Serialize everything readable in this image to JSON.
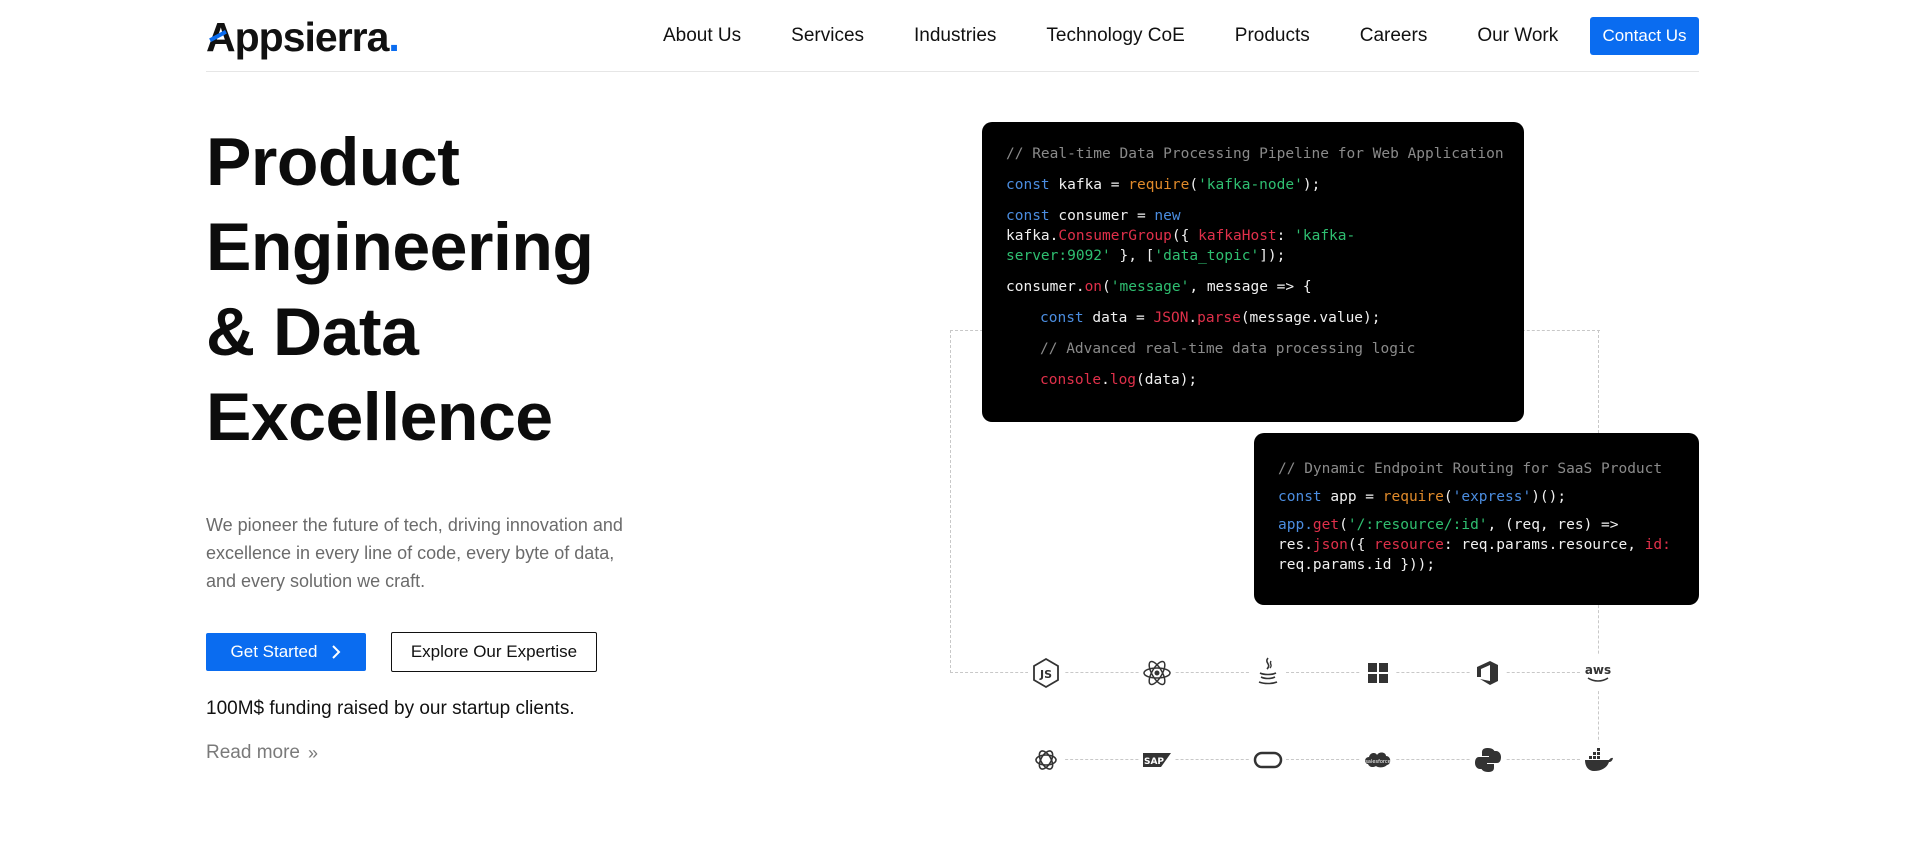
{
  "header": {
    "logo_text": "Appsierra",
    "logo_dot": ".",
    "nav": [
      "About Us",
      "Services",
      "Industries",
      "Technology CoE",
      "Products",
      "Careers",
      "Our Work"
    ],
    "contact_label": "Contact Us"
  },
  "hero": {
    "title_lines": [
      "Product",
      "Engineering",
      "& Data",
      "Excellence"
    ],
    "description": "We pioneer the future of tech, driving innovation and excellence in every line of code, every byte of data, and every solution we craft.",
    "primary_button": "Get Started",
    "secondary_button": "Explore Our Expertise",
    "funding_text": "100M$ funding raised by our startup clients.",
    "read_more": "Read more"
  },
  "code_card_1": {
    "comment": "// Real-time Data Processing Pipeline for Web Application",
    "l1_kw": "const",
    "l1_a": " kafka = ",
    "l1_fn": "require",
    "l1_b": "(",
    "l1_str": "'kafka-node'",
    "l1_c": ");",
    "l2_kw": "const",
    "l2_a": " consumer = ",
    "l2_kw2": "new",
    "l3_a": "kafka.",
    "l3_fn": "ConsumerGroup",
    "l3_b": "({ ",
    "l3_key": "kafkaHost",
    "l3_c": ": ",
    "l3_str": "'kafka-",
    "l4_str": "server:9092'",
    "l4_a": " }, [",
    "l4_str2": "'data_topic'",
    "l4_b": "]);",
    "l5_a": "consumer.",
    "l5_fn": "on",
    "l5_b": "(",
    "l5_str": "'message'",
    "l5_c": ", message => {",
    "l6_kw": "const",
    "l6_a": " data = ",
    "l6_fn": "JSON",
    "l6_b": ".",
    "l6_fn2": "parse",
    "l6_c": "(message.value);",
    "l7_cm": "// Advanced real-time data processing logic",
    "l8_fn": "console",
    "l8_a": ".",
    "l8_fn2": "log",
    "l8_b": "(data);"
  },
  "code_card_2": {
    "comment": "// Dynamic Endpoint Routing for SaaS Product",
    "l1_kw": "const",
    "l1_a": " app = ",
    "l1_fn": "require",
    "l1_b": "(",
    "l1_str": "'express'",
    "l1_c": ")();",
    "l2_kw": "app.",
    "l2_fn": "get",
    "l2_a": "(",
    "l2_str": "'/:resource/:id'",
    "l2_b": ", (req, res) =>",
    "l3_a": "res.",
    "l3_fn": "json",
    "l3_b": "({ ",
    "l3_key": "resource",
    "l3_c": ": req.params.resource, ",
    "l3_key2": "id:",
    "l4_a": "req.params.id }));"
  },
  "tech_icons": {
    "row1": [
      "nodejs-icon",
      "react-icon",
      "java-icon",
      "windows-icon",
      "azure-devops-icon",
      "aws-icon"
    ],
    "row2": [
      "openai-icon",
      "sap-icon",
      "oracle-icon",
      "salesforce-icon",
      "python-icon",
      "docker-icon"
    ],
    "aws_label": "aws",
    "sap_label": "SAP",
    "salesforce_label": "salesforce"
  }
}
